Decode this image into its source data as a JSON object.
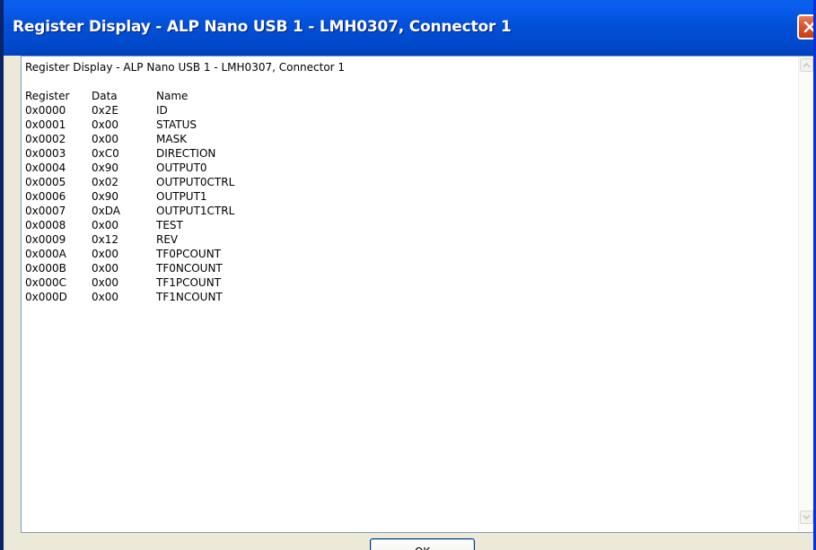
{
  "window": {
    "title": "Register Display - ALP Nano USB 1 - LMH0307, Connector 1"
  },
  "content": {
    "heading": "Register Display - ALP Nano USB 1 - LMH0307, Connector 1",
    "headers": [
      "Register",
      "Data",
      "Name"
    ],
    "rows": [
      [
        "0x0000",
        "0x2E",
        "ID"
      ],
      [
        "0x0001",
        "0x00",
        "STATUS"
      ],
      [
        "0x0002",
        "0x00",
        "MASK"
      ],
      [
        "0x0003",
        "0xC0",
        "DIRECTION"
      ],
      [
        "0x0004",
        "0x90",
        "OUTPUT0"
      ],
      [
        "0x0005",
        "0x02",
        "OUTPUT0CTRL"
      ],
      [
        "0x0006",
        "0x90",
        "OUTPUT1"
      ],
      [
        "0x0007",
        "0xDA",
        "OUTPUT1CTRL"
      ],
      [
        "0x0008",
        "0x00",
        "TEST"
      ],
      [
        "0x0009",
        "0x12",
        "REV"
      ],
      [
        "0x000A",
        "0x00",
        "TF0PCOUNT"
      ],
      [
        "0x000B",
        "0x00",
        "TF0NCOUNT"
      ],
      [
        "0x000C",
        "0x00",
        "TF1PCOUNT"
      ],
      [
        "0x000D",
        "0x00",
        "TF1NCOUNT"
      ]
    ]
  },
  "buttons": {
    "ok_label": "OK"
  },
  "icons": {
    "close": "close-icon",
    "scroll_up": "chevron-up-icon",
    "scroll_down": "chevron-down-icon"
  },
  "colors": {
    "titlebar": "#0250d8",
    "close_button": "#d9522a",
    "window_face": "#ece9d8"
  }
}
